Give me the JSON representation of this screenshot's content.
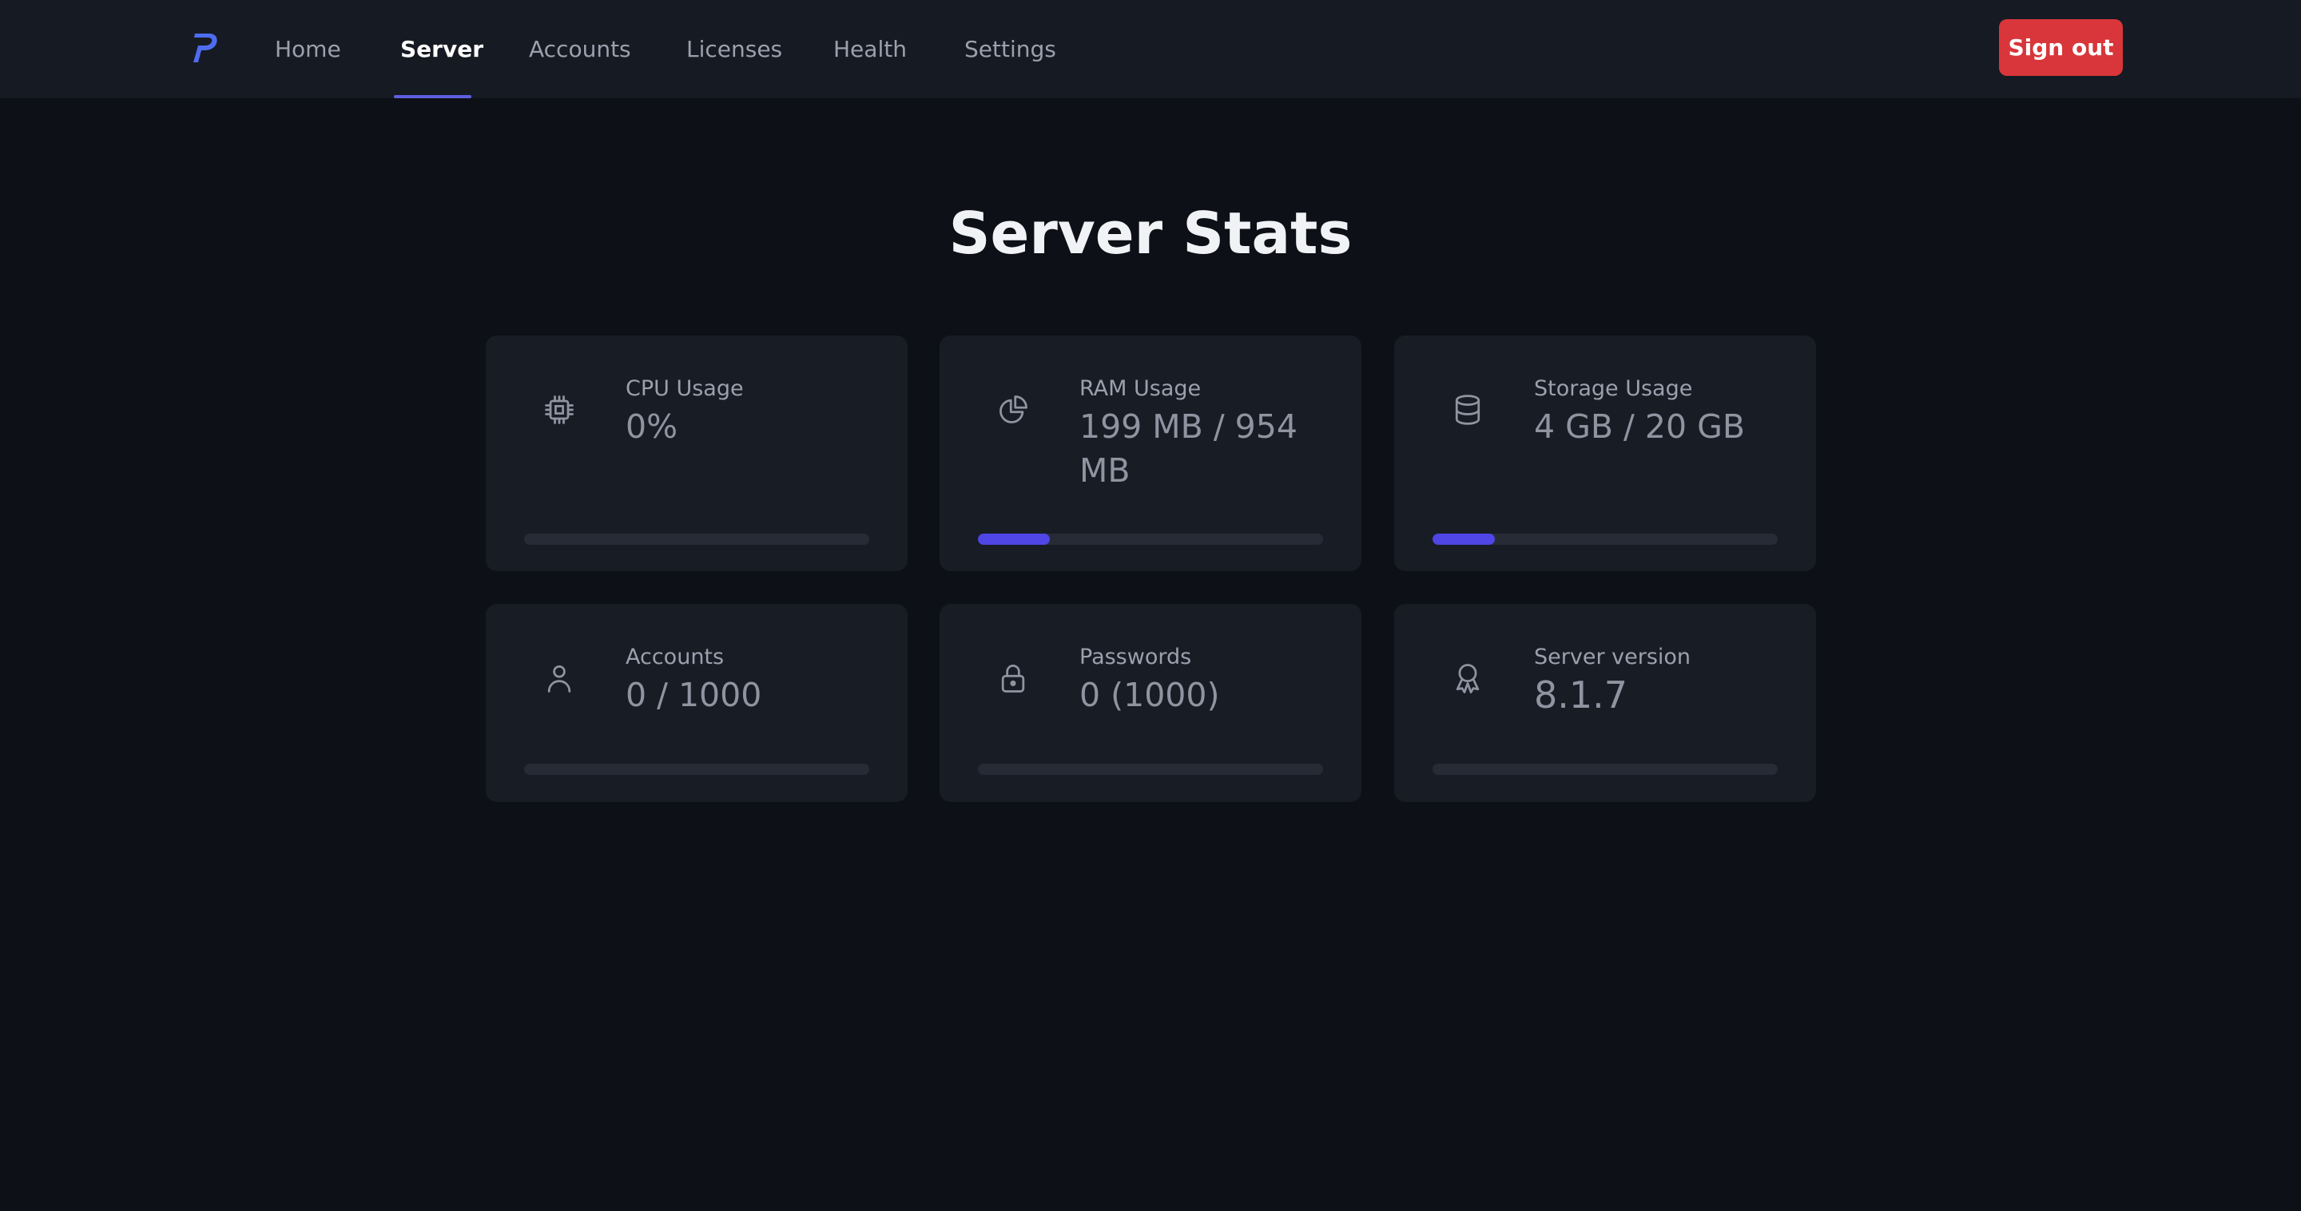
{
  "nav": {
    "items": [
      {
        "label": "Home",
        "active": false
      },
      {
        "label": "Server",
        "active": true
      },
      {
        "label": "Accounts",
        "active": false
      },
      {
        "label": "Licenses",
        "active": false
      },
      {
        "label": "Health",
        "active": false
      },
      {
        "label": "Settings",
        "active": false
      }
    ],
    "sign_out_label": "Sign out"
  },
  "page": {
    "title": "Server Stats"
  },
  "stats": [
    {
      "icon": "cpu-icon",
      "label": "CPU Usage",
      "value": "0%",
      "progress": 0
    },
    {
      "icon": "pie-chart-icon",
      "label": "RAM Usage",
      "value": "199 MB / 954 MB",
      "progress": 0.209
    },
    {
      "icon": "database-icon",
      "label": "Storage Usage",
      "value": "4 GB / 20 GB",
      "progress": 0.18
    },
    {
      "icon": "user-icon",
      "label": "Accounts",
      "value": "0 / 1000",
      "progress": 0
    },
    {
      "icon": "lock-icon",
      "label": "Passwords",
      "value": "0 (1000)",
      "progress": 0
    },
    {
      "icon": "award-icon",
      "label": "Server version",
      "value": "8.1.7",
      "progress": 0
    }
  ],
  "colors": {
    "background": "#0d1016",
    "navbar": "#161a23",
    "card": "#181c25",
    "accent": "#4f46e5",
    "danger": "#d8363a"
  }
}
